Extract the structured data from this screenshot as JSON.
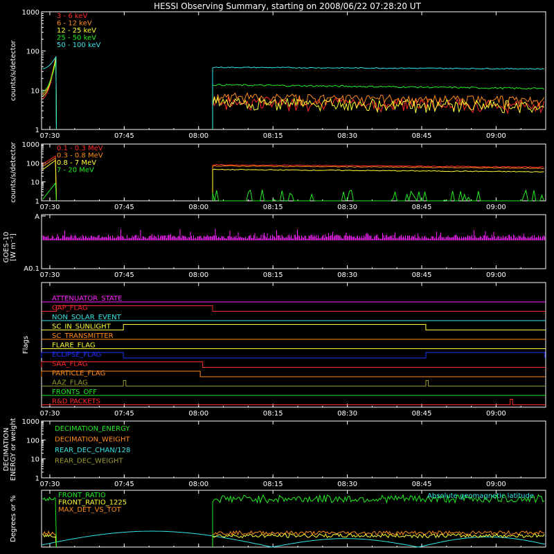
{
  "title": "HESSI Observing Summary, starting on 2008/06/22 07:28:20 UT",
  "time_ticks": [
    "07:30",
    "07:45",
    "08:00",
    "08:15",
    "08:30",
    "08:45",
    "09:00"
  ],
  "colors": {
    "red": "#ff2a2a",
    "orange": "#ff8c1a",
    "yellow": "#ffff33",
    "green": "#22ee22",
    "cyan": "#33e6e6",
    "magenta": "#ff22ff",
    "blue": "#2233ff",
    "olive": "#9a9a2a",
    "white": "#ffffff"
  },
  "chart_data": [
    {
      "type": "line",
      "id": "hxr",
      "ylabel": "counts/s/detector",
      "scale": "log",
      "ylim": [
        1,
        1000
      ],
      "yticks": [
        "1",
        "10",
        "100",
        "1000"
      ],
      "x_unit": "minutes since 07:28:20 UT",
      "gaps": [
        [
          3.0,
          34.5
        ]
      ],
      "series": [
        {
          "name": "3 - 6 keV",
          "color": "red",
          "start": [
            6,
            80
          ],
          "plateau": 4.5,
          "noise": 0.25
        },
        {
          "name": "6 - 12 keV",
          "color": "orange",
          "start": [
            8,
            85
          ],
          "plateau": 6,
          "noise": 0.15
        },
        {
          "name": "12 - 25 keV",
          "color": "yellow",
          "start": [
            7,
            80
          ],
          "plateau": 4.3,
          "noise": 0.25
        },
        {
          "name": "25 - 50 keV",
          "color": "green",
          "start": [
            9,
            60
          ],
          "plateau": 11,
          "noise": 0.05
        },
        {
          "name": "50 - 100 keV",
          "color": "cyan",
          "start": [
            35,
            75
          ],
          "plateau": 35,
          "noise": 0.03
        }
      ]
    },
    {
      "type": "line",
      "id": "gamma",
      "ylabel": "counts/s/detector",
      "scale": "log",
      "ylim": [
        1,
        1000
      ],
      "yticks": [
        "1",
        "10",
        "100",
        "1000"
      ],
      "gaps": [
        [
          3.0,
          34.5
        ]
      ],
      "series": [
        {
          "name": "0.1 - 0.3 MeV",
          "color": "red",
          "start": [
            80,
            250
          ],
          "plateau": 80,
          "noise": 0.05
        },
        {
          "name": "0.3 - 0.8 MeV",
          "color": "orange",
          "start": [
            60,
            200
          ],
          "plateau": 70,
          "noise": 0.05
        },
        {
          "name": "0.8 - 7 MeV",
          "color": "yellow",
          "start": [
            40,
            150
          ],
          "plateau": 45,
          "noise": 0.05
        },
        {
          "name": "7 - 20 MeV",
          "color": "green",
          "start": [
            1,
            10
          ],
          "plateau": 1,
          "noise": 0
        }
      ]
    },
    {
      "type": "line",
      "id": "goes",
      "ylabel": "GOES-10",
      "ylabel2": "[W m⁻²]",
      "ytick_top": "A",
      "ytick_bottom": "A0.1",
      "series": [
        {
          "name": "GOES-10 flux",
          "color": "magenta"
        }
      ]
    },
    {
      "type": "table",
      "id": "flags",
      "ylabel": "Flags",
      "flags": [
        {
          "name": "ATTENUATOR_STATE",
          "color": "magenta",
          "on": []
        },
        {
          "name": "GAP_FLAG",
          "color": "red",
          "on": [
            [
              3.0,
              34.5
            ]
          ]
        },
        {
          "name": "NON_SOLAR_EVENT",
          "color": "cyan",
          "on": []
        },
        {
          "name": "SC_IN_SUNLIGHT",
          "color": "yellow",
          "on": [
            [
              16.5,
              77.5
            ]
          ]
        },
        {
          "name": "SC_TRANSMITTER",
          "color": "orange",
          "on": []
        },
        {
          "name": "FLARE_FLAG",
          "color": "yellow",
          "on": []
        },
        {
          "name": "ECLIPSE_FLAG",
          "color": "blue",
          "on": [
            [
              0,
              16.5
            ],
            [
              77.5,
              101.5
            ]
          ]
        },
        {
          "name": "SAA_FLAG",
          "color": "red",
          "on": [
            [
              0,
              32.5
            ]
          ]
        },
        {
          "name": "PARTICLE_FLAG",
          "color": "orange",
          "on": [
            [
              0,
              32
            ]
          ]
        },
        {
          "name": "AAZ_FLAG",
          "color": "olive",
          "on": [
            [
              16.5,
              17
            ],
            [
              77.5,
              78
            ]
          ]
        },
        {
          "name": "FRONTS_OFF",
          "color": "green",
          "on": []
        },
        {
          "name": "R&D PACKETS",
          "color": "red",
          "on": [
            [
              94.5,
              95
            ]
          ]
        }
      ]
    },
    {
      "type": "line",
      "id": "decim",
      "ylabel": "DECIMATION",
      "ylabel2": "ENERGY or weight",
      "scale": "log",
      "ylim": [
        1,
        1000
      ],
      "yticks": [
        "1",
        "10",
        "100",
        "1000"
      ],
      "series": [
        {
          "name": "DECIMATION_ENERGY",
          "color": "green"
        },
        {
          "name": "DECIMATION_WEIGHT",
          "color": "orange"
        },
        {
          "name": "REAR_DEC_CHAN/128",
          "color": "cyan"
        },
        {
          "name": "REAR_DEC_WEIGHT",
          "color": "olive"
        }
      ]
    },
    {
      "type": "line",
      "id": "ratio",
      "ylabel": "Degrees or %",
      "scale": "linear",
      "ylim": [
        0,
        100
      ],
      "annotation": "Absolute geomagnetic latitude",
      "series": [
        {
          "name": "FRONT_RATIO",
          "color": "green",
          "level": 85
        },
        {
          "name": "FRONT_RATIO_1225",
          "color": "yellow",
          "level": 20
        },
        {
          "name": "MAX_DET_VS_TOT",
          "color": "orange",
          "level": 25
        },
        {
          "name": "Absolute geomagnetic latitude",
          "color": "cyan",
          "peak": 28
        }
      ]
    }
  ]
}
